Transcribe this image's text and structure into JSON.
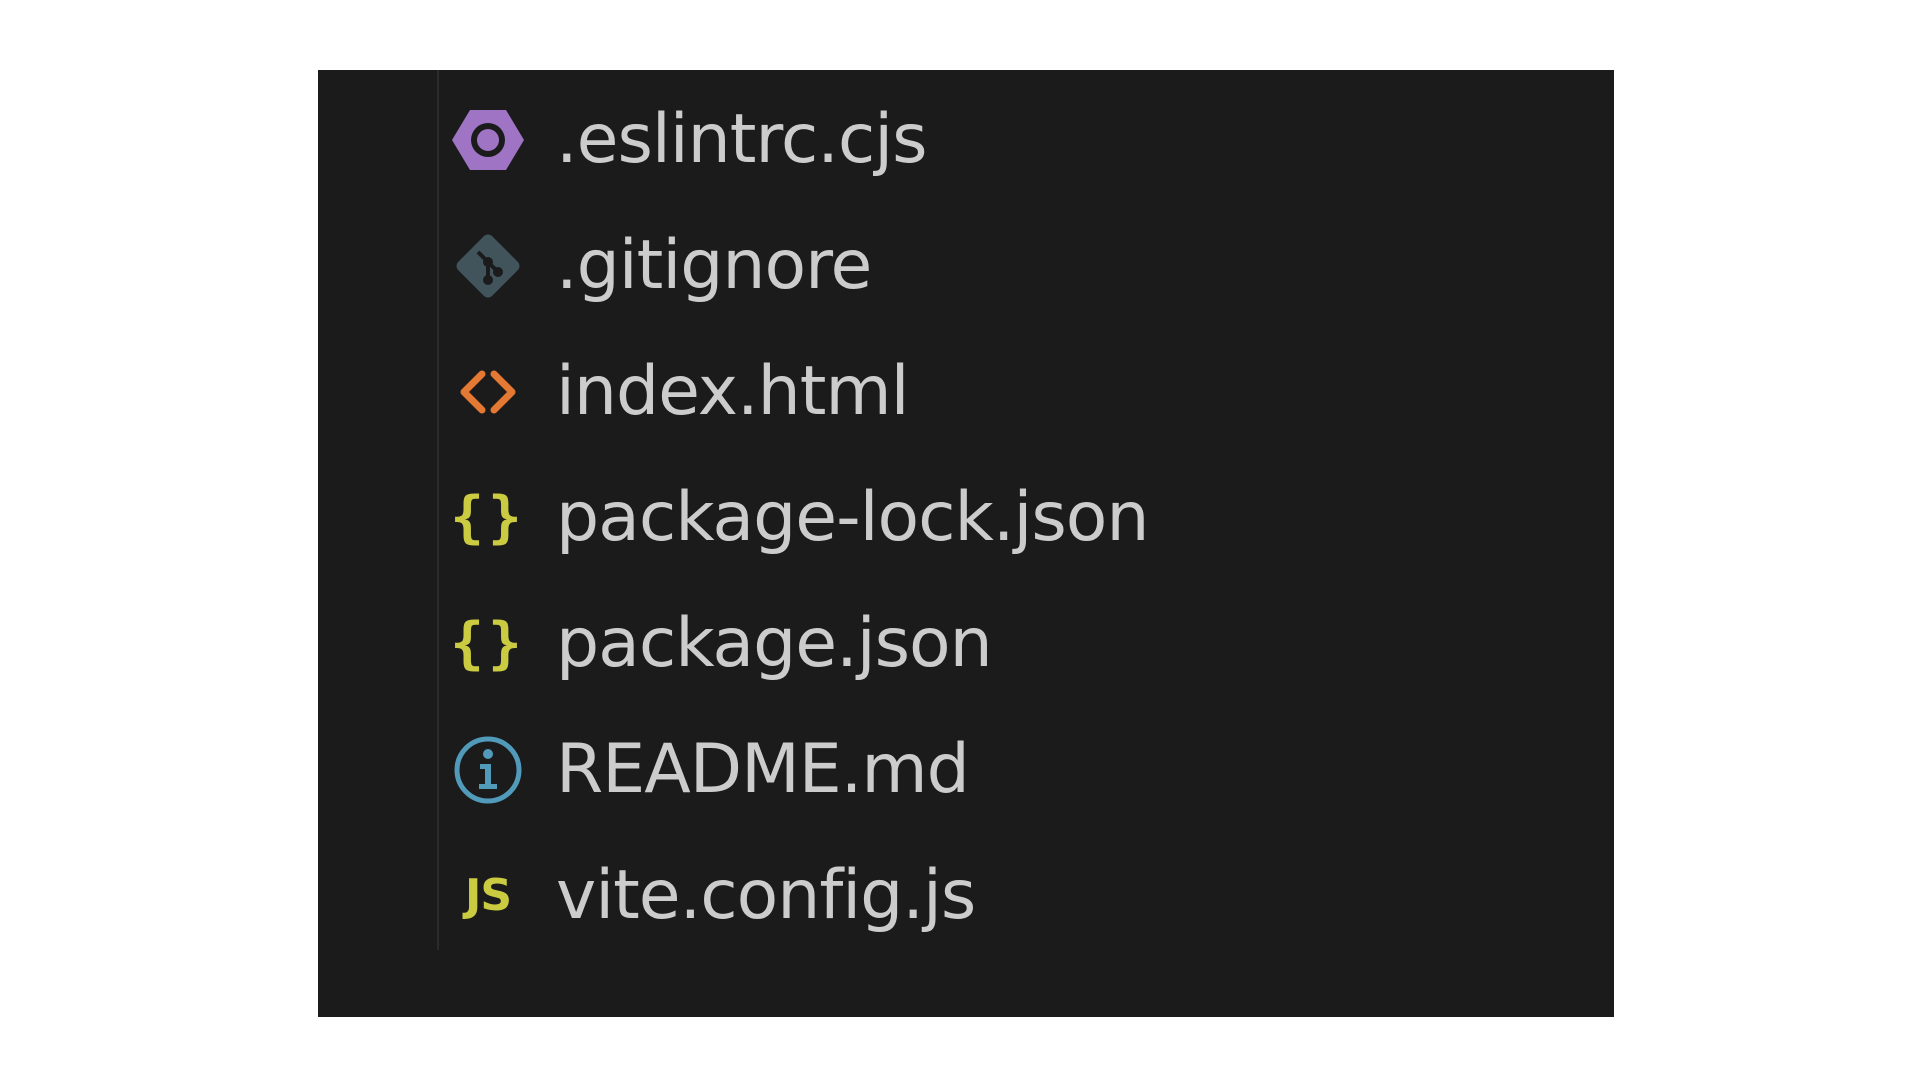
{
  "explorer": {
    "colors": {
      "background": "#1b1b1b",
      "text": "#cccccc",
      "eslint": "#a074c4",
      "git": "#41535b",
      "html": "#e37933",
      "json": "#cbcb41",
      "info": "#519aba",
      "javascript": "#cbcb41"
    },
    "files": [
      {
        "name": ".eslintrc.cjs",
        "icon": "eslint-icon"
      },
      {
        "name": ".gitignore",
        "icon": "git-icon"
      },
      {
        "name": "index.html",
        "icon": "html-icon"
      },
      {
        "name": "package-lock.json",
        "icon": "json-icon"
      },
      {
        "name": "package.json",
        "icon": "json-icon"
      },
      {
        "name": "README.md",
        "icon": "info-icon"
      },
      {
        "name": "vite.config.js",
        "icon": "javascript-icon"
      }
    ]
  }
}
